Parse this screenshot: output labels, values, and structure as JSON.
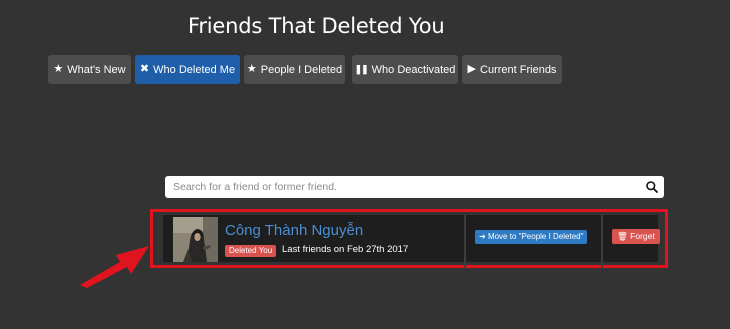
{
  "page": {
    "title": "Friends That Deleted You"
  },
  "tabs": [
    {
      "label": "What's New",
      "icon": "star-icon",
      "active": false
    },
    {
      "label": "Who Deleted Me",
      "icon": "x-icon",
      "active": true
    },
    {
      "label": "People I Deleted",
      "icon": "star-icon",
      "active": false
    },
    {
      "label": "Who Deactivated",
      "icon": "pause-icon",
      "active": false
    },
    {
      "label": "Current Friends",
      "icon": "play-icon",
      "active": false
    }
  ],
  "search": {
    "placeholder": "Search for a friend or former friend.",
    "icon": "search-icon"
  },
  "friend": {
    "name": "Công Thành Nguyễn",
    "status_badge": "Deleted You",
    "last_friends": "Last friends on Feb 27th 2017",
    "move_button": "Move to \"People I Deleted\"",
    "forget_button": "Forget"
  },
  "colors": {
    "background": "#333333",
    "tab": "#4d4d4d",
    "tab_active": "#1f5ea8",
    "name": "#4a8fd4",
    "danger": "#d9534f",
    "primary": "#2e7bc4",
    "highlight": "#e0141e"
  }
}
